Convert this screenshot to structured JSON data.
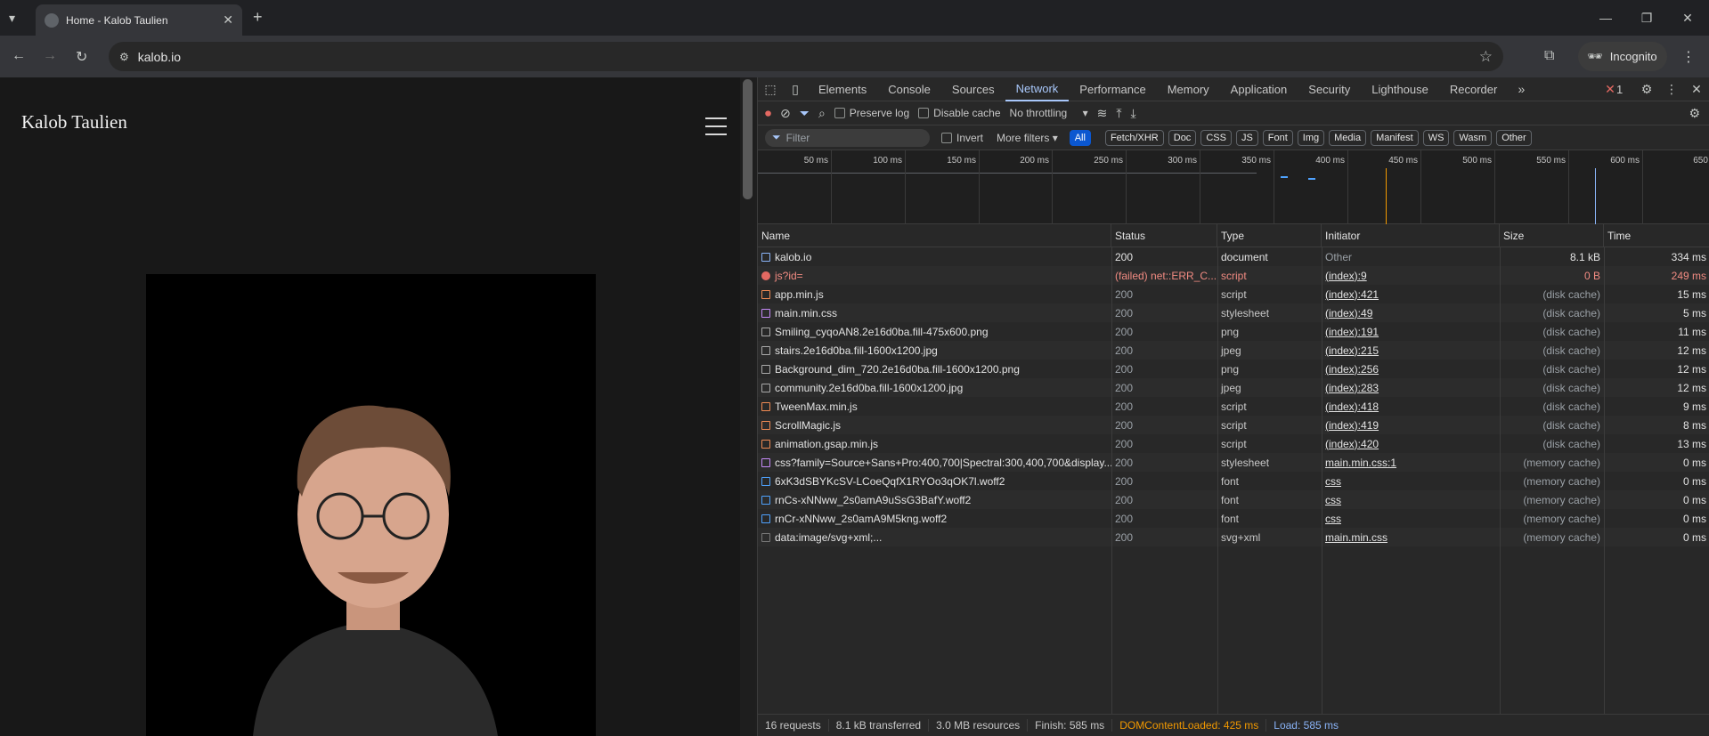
{
  "browser": {
    "tab_title": "Home - Kalob Taulien",
    "new_tab": "+",
    "url": "kalob.io",
    "incognito": "Incognito"
  },
  "page": {
    "site_title": "Kalob Taulien"
  },
  "devtools": {
    "tabs": [
      "Elements",
      "Console",
      "Sources",
      "Network",
      "Performance",
      "Memory",
      "Application",
      "Security",
      "Lighthouse",
      "Recorder"
    ],
    "active_tab": "Network",
    "error_count": "1",
    "toolbar": {
      "preserve_log": "Preserve log",
      "disable_cache": "Disable cache",
      "throttling": "No throttling"
    },
    "filter": {
      "placeholder": "Filter",
      "invert": "Invert",
      "more_filters": "More filters",
      "types": [
        "All",
        "Fetch/XHR",
        "Doc",
        "CSS",
        "JS",
        "Font",
        "Img",
        "Media",
        "Manifest",
        "WS",
        "Wasm",
        "Other"
      ]
    },
    "timeline_ticks": [
      "50 ms",
      "100 ms",
      "150 ms",
      "200 ms",
      "250 ms",
      "300 ms",
      "350 ms",
      "400 ms",
      "450 ms",
      "500 ms",
      "550 ms",
      "600 ms",
      "650 r"
    ],
    "columns": [
      "Name",
      "Status",
      "Type",
      "Initiator",
      "Size",
      "Time"
    ],
    "rows": [
      {
        "name": "kalob.io",
        "status": "200",
        "type": "document",
        "initiator": "Other",
        "size": "8.1 kB",
        "time": "334 ms",
        "icon": "doc",
        "link": false,
        "error": false
      },
      {
        "name": "js?id=",
        "status": "(failed) net::ERR_C...",
        "type": "script",
        "initiator": "(index):9",
        "size": "0 B",
        "time": "249 ms",
        "icon": "err",
        "link": true,
        "error": true
      },
      {
        "name": "app.min.js",
        "status": "200",
        "type": "script",
        "initiator": "(index):421",
        "size": "(disk cache)",
        "time": "15 ms",
        "icon": "js",
        "link": true,
        "error": false
      },
      {
        "name": "main.min.css",
        "status": "200",
        "type": "stylesheet",
        "initiator": "(index):49",
        "size": "(disk cache)",
        "time": "5 ms",
        "icon": "css",
        "link": true,
        "error": false
      },
      {
        "name": "Smiling_cyqoAN8.2e16d0ba.fill-475x600.png",
        "status": "200",
        "type": "png",
        "initiator": "(index):191",
        "size": "(disk cache)",
        "time": "11 ms",
        "icon": "img",
        "link": true,
        "error": false
      },
      {
        "name": "stairs.2e16d0ba.fill-1600x1200.jpg",
        "status": "200",
        "type": "jpeg",
        "initiator": "(index):215",
        "size": "(disk cache)",
        "time": "12 ms",
        "icon": "img",
        "link": true,
        "error": false
      },
      {
        "name": "Background_dim_720.2e16d0ba.fill-1600x1200.png",
        "status": "200",
        "type": "png",
        "initiator": "(index):256",
        "size": "(disk cache)",
        "time": "12 ms",
        "icon": "img",
        "link": true,
        "error": false
      },
      {
        "name": "community.2e16d0ba.fill-1600x1200.jpg",
        "status": "200",
        "type": "jpeg",
        "initiator": "(index):283",
        "size": "(disk cache)",
        "time": "12 ms",
        "icon": "img",
        "link": true,
        "error": false
      },
      {
        "name": "TweenMax.min.js",
        "status": "200",
        "type": "script",
        "initiator": "(index):418",
        "size": "(disk cache)",
        "time": "9 ms",
        "icon": "js",
        "link": true,
        "error": false
      },
      {
        "name": "ScrollMagic.js",
        "status": "200",
        "type": "script",
        "initiator": "(index):419",
        "size": "(disk cache)",
        "time": "8 ms",
        "icon": "js",
        "link": true,
        "error": false
      },
      {
        "name": "animation.gsap.min.js",
        "status": "200",
        "type": "script",
        "initiator": "(index):420",
        "size": "(disk cache)",
        "time": "13 ms",
        "icon": "js",
        "link": true,
        "error": false
      },
      {
        "name": "css?family=Source+Sans+Pro:400,700|Spectral:300,400,700&display...",
        "status": "200",
        "type": "stylesheet",
        "initiator": "main.min.css:1",
        "size": "(memory cache)",
        "time": "0 ms",
        "icon": "css",
        "link": true,
        "error": false
      },
      {
        "name": "6xK3dSBYKcSV-LCoeQqfX1RYOo3qOK7l.woff2",
        "status": "200",
        "type": "font",
        "initiator": "css",
        "size": "(memory cache)",
        "time": "0 ms",
        "icon": "font",
        "link": true,
        "error": false
      },
      {
        "name": "rnCs-xNNww_2s0amA9uSsG3BafY.woff2",
        "status": "200",
        "type": "font",
        "initiator": "css",
        "size": "(memory cache)",
        "time": "0 ms",
        "icon": "font",
        "link": true,
        "error": false
      },
      {
        "name": "rnCr-xNNww_2s0amA9M5kng.woff2",
        "status": "200",
        "type": "font",
        "initiator": "css",
        "size": "(memory cache)",
        "time": "0 ms",
        "icon": "font",
        "link": true,
        "error": false
      },
      {
        "name": "data:image/svg+xml;...",
        "status": "200",
        "type": "svg+xml",
        "initiator": "main.min.css",
        "size": "(memory cache)",
        "time": "0 ms",
        "icon": "svg",
        "link": true,
        "error": false
      }
    ],
    "summary": {
      "requests": "16 requests",
      "transferred": "8.1 kB transferred",
      "resources": "3.0 MB resources",
      "finish": "Finish: 585 ms",
      "dcl": "DOMContentLoaded: 425 ms",
      "load": "Load: 585 ms"
    },
    "colors": {
      "dcl": "#f29900",
      "load": "#8ab4f8",
      "accent": "#a8c7fa"
    }
  }
}
